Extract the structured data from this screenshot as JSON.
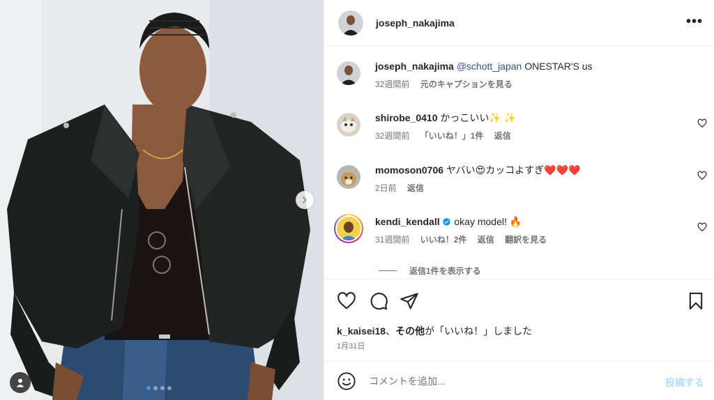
{
  "post": {
    "author": "joseph_nakajima",
    "more_icon": "more-horizontal-icon",
    "carousel": {
      "count": 4,
      "active_index": 0
    }
  },
  "comments": [
    {
      "user": "joseph_nakajima",
      "mention": "@schott_japan",
      "text": "ONESTAR'S us",
      "time": "32週間前",
      "action": "元のキャプションを見る"
    },
    {
      "user": "shirobe_0410",
      "text": "かっこいい✨ ✨",
      "time": "32週間前",
      "likes": "「いいね！」1件",
      "reply": "返信"
    },
    {
      "user": "momoson0706",
      "text": "ヤバい😍カッコよすぎ❤️❤️❤️",
      "time": "2日前",
      "reply": "返信"
    },
    {
      "user": "kendi_kendall",
      "verified": true,
      "text": "okay model! 🔥",
      "time": "31週間前",
      "likes": "いいね！2件",
      "reply": "返信",
      "translate": "翻訳を見る",
      "view_replies": "返信1件を表示する"
    }
  ],
  "likes_line": {
    "user": "k_kaisei18",
    "sep": "、",
    "others": "その他",
    "suffix": "が「いいね！」しました"
  },
  "date": "1月31日",
  "composer": {
    "placeholder": "コメントを追加...",
    "post_label": "投稿する"
  },
  "colors": {
    "text": "#262626",
    "secondary": "#737373",
    "link": "#385185",
    "post_disabled": "#b2dffc",
    "verified": "#0095f6",
    "carousel_active": "#3897f0"
  }
}
